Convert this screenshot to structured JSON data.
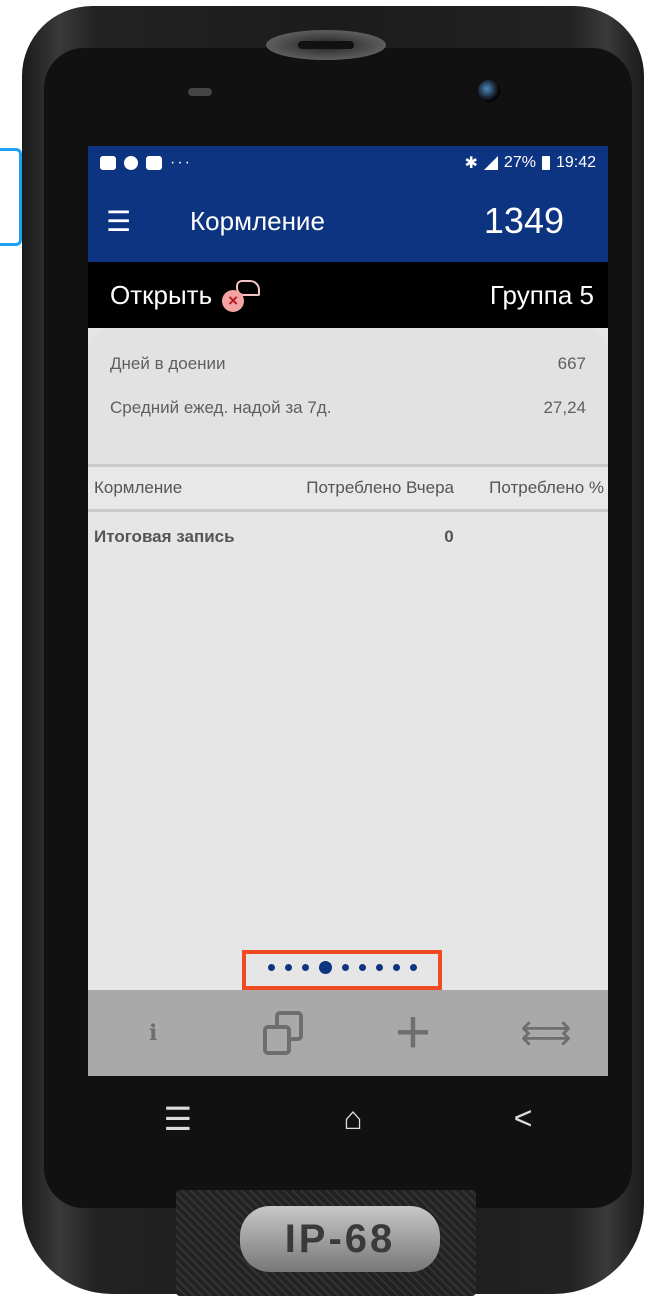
{
  "statusbar": {
    "more": "···",
    "battery_pct": "27%",
    "time": "19:42"
  },
  "appbar": {
    "title": "Кормление",
    "count": "1349"
  },
  "subbar": {
    "open_label": "Открыть",
    "x_mark": "×",
    "group_label": "Группа 5"
  },
  "info": {
    "rows": [
      {
        "label": "Дней в доении",
        "value": "667"
      },
      {
        "label": "Средний ежед. надой за 7д.",
        "value": "27,24"
      }
    ]
  },
  "table": {
    "headers": [
      "Кормление",
      "Потреблено Вчера",
      "Потреблено %"
    ],
    "rows": [
      {
        "name": "Итоговая запись",
        "value": "0"
      }
    ]
  },
  "pager": {
    "total": 9,
    "active_index": 3
  },
  "toolbar": {
    "plus": "+",
    "arrows": "⇇⇉",
    "cow_info": "ℹ"
  },
  "nav": {
    "menu": "☰",
    "home": "⌂",
    "back": "<"
  },
  "device": {
    "badge": "IP-68"
  },
  "colors": {
    "brand": "#0d3480",
    "highlight": "#f04a24"
  }
}
